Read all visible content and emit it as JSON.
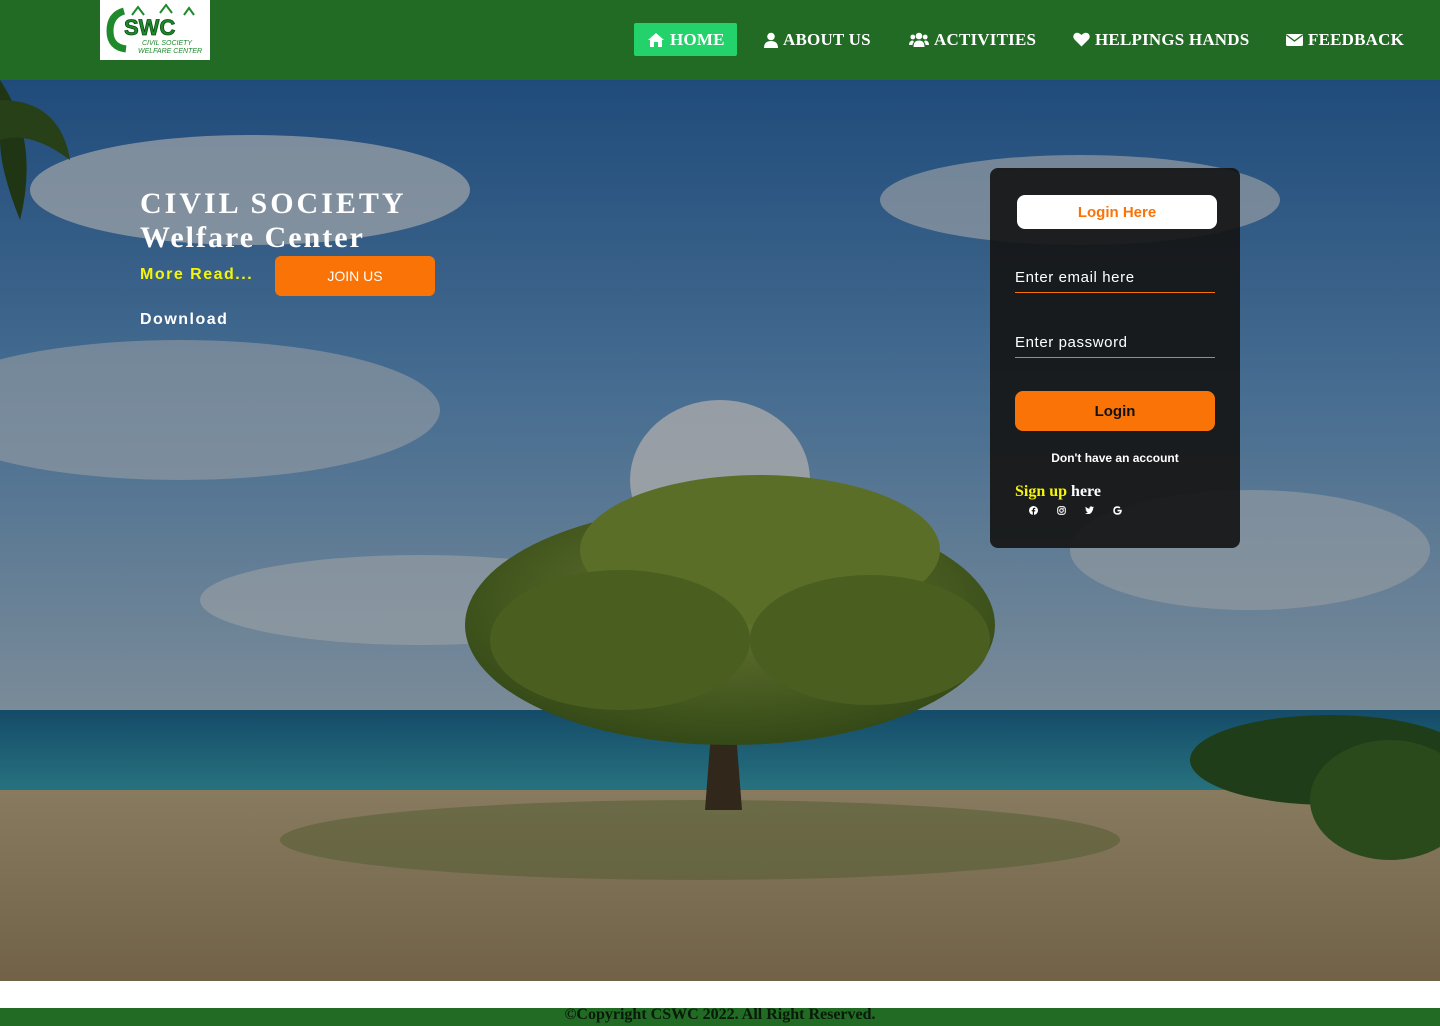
{
  "brand": {
    "logo_text": "CSWC",
    "logo_subtext": "CIVIL SOCIETY WELFARE CENTER"
  },
  "nav": {
    "items": [
      {
        "label": "HOME",
        "icon": "home-icon",
        "active": true
      },
      {
        "label": "ABOUT US",
        "icon": "user-icon"
      },
      {
        "label": "ACTIVITIES",
        "icon": "users-icon"
      },
      {
        "label": "HELPINGS HANDS",
        "icon": "heart-icon"
      },
      {
        "label": "FEEDBACK",
        "icon": "envelope-icon"
      }
    ]
  },
  "hero": {
    "title_line1": "CIVIL SOCIETY",
    "title_line2": "Welfare Center",
    "more_read": "More Read...",
    "join_button": "JOIN US",
    "download": "Download"
  },
  "login": {
    "header": "Login Here",
    "email_placeholder": "Enter email here",
    "password_placeholder": "Enter password",
    "button": "Login",
    "no_account": "Don't have an account",
    "signup_link": "Sign up",
    "signup_rest": " here",
    "socials": [
      "facebook-icon",
      "instagram-icon",
      "twitter-icon",
      "google-icon"
    ]
  },
  "footer": {
    "copyright": "©Copyright CSWC 2022. All Right Reserved."
  },
  "colors": {
    "header_green": "#216b24",
    "active_green": "#23d26a",
    "accent_orange": "#f97306",
    "link_yellow": "#f5f50a"
  }
}
